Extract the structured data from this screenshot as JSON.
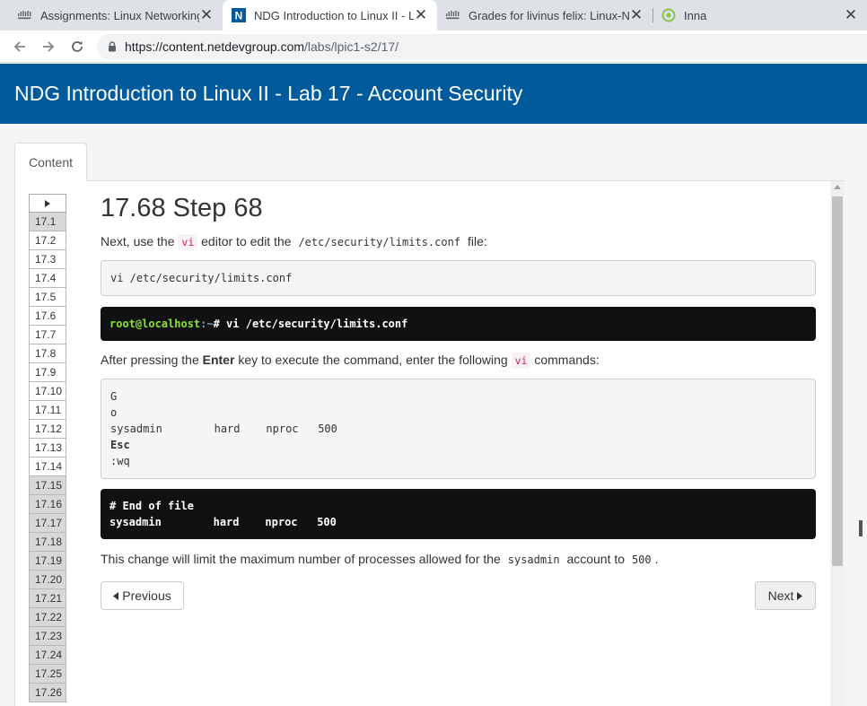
{
  "browser": {
    "tabs": [
      {
        "title": "Assignments: Linux Networking",
        "favicon": "cisco-icon",
        "close": "✕"
      },
      {
        "title": "NDG Introduction to Linux II - Lab",
        "favicon": "ndg-n-icon",
        "close": "✕"
      },
      {
        "title": "Grades for livinus felix: Linux-Net",
        "favicon": "cisco-icon",
        "close": "✕"
      },
      {
        "title": "Inna",
        "favicon": "target-circle-icon",
        "close": "✕"
      }
    ],
    "url_host": "https://content.netdevgroup.com",
    "url_path": "/labs/lpic1-s2/17/"
  },
  "page": {
    "header_title": "NDG Introduction to Linux II - Lab 17 - Account Security",
    "content_tab": "Content"
  },
  "steps": [
    "17.1",
    "17.2",
    "17.3",
    "17.4",
    "17.5",
    "17.6",
    "17.7",
    "17.8",
    "17.9",
    "17.10",
    "17.11",
    "17.12",
    "17.13",
    "17.14",
    "17.15",
    "17.16",
    "17.17",
    "17.18",
    "17.19",
    "17.20",
    "17.21",
    "17.22",
    "17.23",
    "17.24",
    "17.25",
    "17.26"
  ],
  "steps_done": [
    0,
    14,
    15,
    16,
    17,
    18,
    19,
    20,
    21,
    22,
    23,
    24,
    25
  ],
  "content": {
    "heading": "17.68 Step 68",
    "p1_a": "Next, use the",
    "p1_code1": "vi",
    "p1_b": "editor to edit the",
    "p1_code2": "/etc/security/limits.conf",
    "p1_c": "file:",
    "cmd_box": "vi /etc/security/limits.conf",
    "term1_user": "root@localhost",
    "term1_path": ":~",
    "term1_cmd": "# vi /etc/security/limits.conf",
    "p2_a": "After pressing the",
    "p2_bold": "Enter",
    "p2_b": "key to execute the command, enter the following",
    "p2_code": "vi",
    "p2_c": "commands:",
    "vi_lines": [
      {
        "text": "G",
        "bold": false
      },
      {
        "text": "o",
        "bold": false
      },
      {
        "text": "sysadmin        hard    nproc   500",
        "bold": false
      },
      {
        "text": "Esc",
        "bold": true
      },
      {
        "text": ":wq",
        "bold": false
      }
    ],
    "term2_lines": [
      "# End of file",
      "sysadmin        hard    nproc   500"
    ],
    "p3_a": "This change will limit the maximum number of processes allowed for the",
    "p3_code1": "sysadmin",
    "p3_b": "account to",
    "p3_code2": "500",
    "p3_c": ".",
    "prev_label": "Previous",
    "next_label": "Next"
  },
  "colors": {
    "header_bg": "#005a9c",
    "inline_code_red": "#c7254e",
    "prompt_green": "#8ae234",
    "prompt_blue": "#729fcf"
  }
}
